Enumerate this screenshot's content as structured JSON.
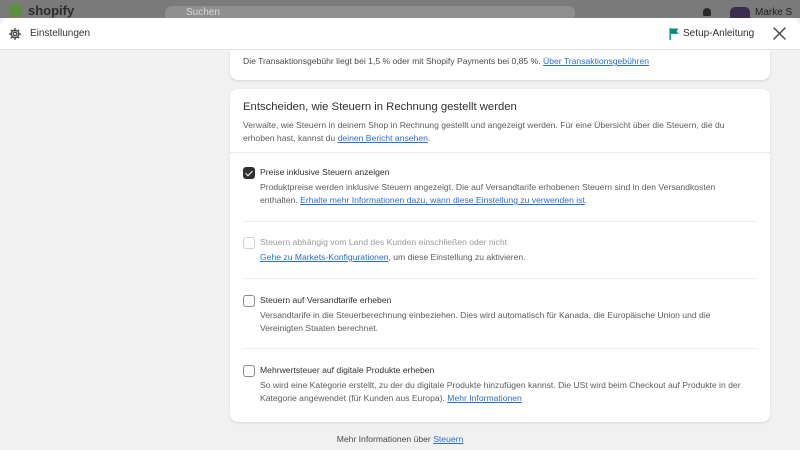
{
  "background": {
    "logo_text": "shopify",
    "search_placeholder": "Suchen",
    "user_name": "Marke S"
  },
  "header": {
    "title": "Einstellungen",
    "setup_label": "Setup-Anleitung"
  },
  "fee": {
    "text": "Die Transaktionsgebühr liegt bei 1,5 % oder mit Shopify Payments bei 0,85 %.",
    "link": "Über Transaktionsgebühren"
  },
  "tax_section": {
    "heading": "Entscheiden, wie Steuern in Rechnung gestellt werden",
    "description": "Verwalte, wie Steuern in deinem Shop in Rechnung gestellt und angezeigt werden. Für eine Übersicht über die Steuern, die du erhoben hast, kannst du",
    "description_link": "deinen Bericht ansehen",
    "description_end": ".",
    "options": [
      {
        "label": "Preise inklusive Steuern anzeigen",
        "checked": true,
        "disabled": false,
        "help": "Produktpreise werden inklusive Steuern angezeigt. Die auf Versandtarife erhobenen Steuern sind in den Versandkosten enthalten.",
        "help_link": "Erhalte mehr Informationen dazu, wann diese Einstellung zu verwenden ist",
        "help_end": "."
      },
      {
        "label": "Steuern abhängig vom Land des Kunden einschließen oder nicht",
        "checked": false,
        "disabled": true,
        "help_link": "Gehe zu Markets-Konfigurationen",
        "help_end": ", um diese Einstellung zu aktivieren."
      },
      {
        "label": "Steuern auf Versandtarife erheben",
        "checked": false,
        "disabled": false,
        "help": "Versandtarife in die Steuerberechnung einbeziehen. Dies wird automatisch für Kanada, die Europäische Union und die Vereinigten Staaten berechnet."
      },
      {
        "label": "Mehrwertsteuer auf digitale Produkte erheben",
        "checked": false,
        "disabled": false,
        "help": "So wird eine Kategorie erstellt, zu der du digitale Produkte hinzufügen kannst. Die USt wird beim Checkout auf Produkte in der Kategorie angewendet (für Kunden aus Europa).",
        "help_link": "Mehr Informationen"
      }
    ]
  },
  "footer": {
    "text": "Mehr Informationen über",
    "link": "Steuern"
  },
  "colors": {
    "accent_link": "#2c6ecb",
    "checkbox_checked": "#303030",
    "flag": "#0a8a7a"
  }
}
